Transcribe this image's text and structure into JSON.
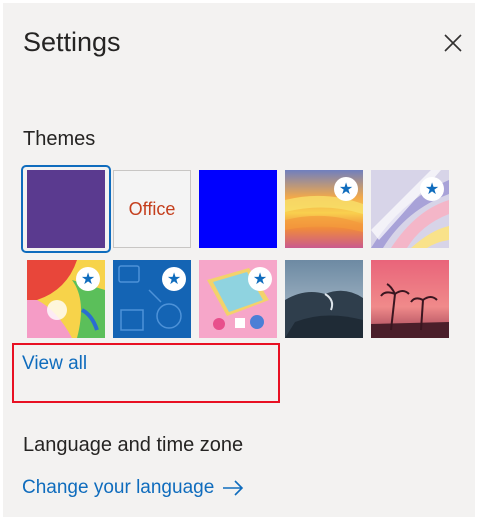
{
  "panel": {
    "title": "Settings",
    "close_icon": "close-icon"
  },
  "themes": {
    "heading": "Themes",
    "items": [
      {
        "name": "purple",
        "color": "#5a3a8f",
        "selected": true
      },
      {
        "name": "office",
        "label": "Office",
        "color": "#f4f4f4"
      },
      {
        "name": "blue",
        "color": "#0000ff"
      },
      {
        "name": "rainbow-waves",
        "starred": true
      },
      {
        "name": "silver-ribbons",
        "starred": true
      },
      {
        "name": "colorful-art",
        "starred": true
      },
      {
        "name": "blue-icons",
        "starred": true
      },
      {
        "name": "pink-board-game",
        "starred": true
      },
      {
        "name": "mountain-landscape"
      },
      {
        "name": "palm-sunset"
      }
    ],
    "view_all": "View all"
  },
  "language": {
    "heading": "Language and time zone",
    "change_link": "Change your language",
    "arrow_icon": "arrow-right-icon"
  },
  "colors": {
    "accent": "#0f6cbd",
    "highlight_box": "#e81123"
  }
}
